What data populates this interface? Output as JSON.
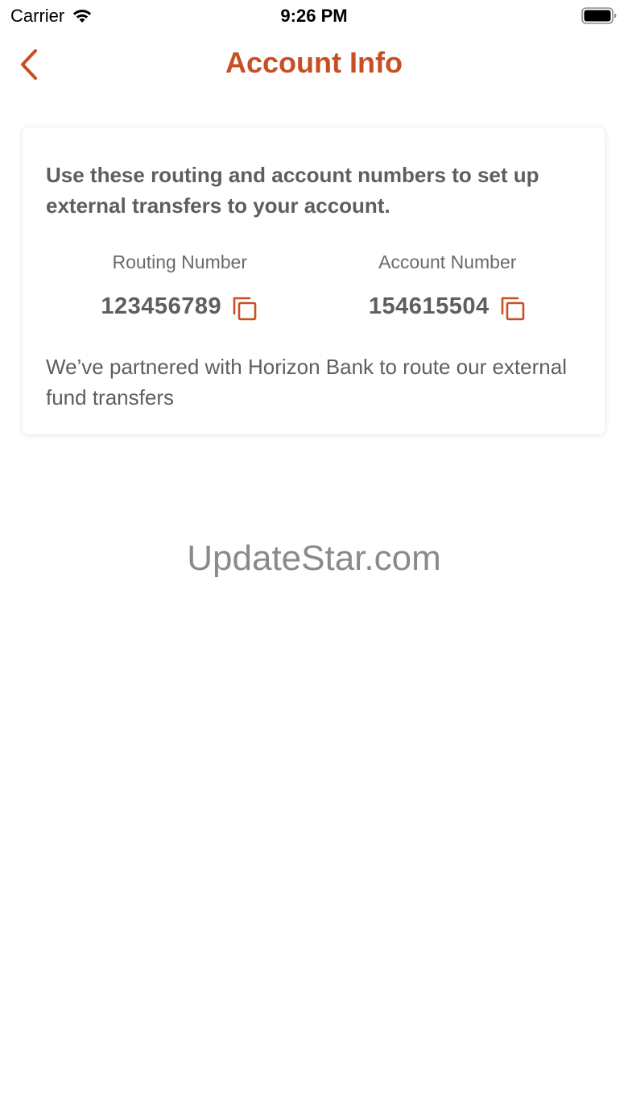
{
  "status_bar": {
    "carrier": "Carrier",
    "time": "9:26 PM"
  },
  "nav": {
    "title": "Account Info",
    "back_icon": "chevron-left-icon"
  },
  "card": {
    "intro": "Use these routing and account numbers to set up external transfers to your account.",
    "routing": {
      "label": "Routing Number",
      "value": "123456789"
    },
    "account": {
      "label": "Account Number",
      "value": "154615504"
    },
    "partner_note": "We’ve partnered with Horizon Bank to route our external fund transfers"
  },
  "watermark": "UpdateStar.com",
  "colors": {
    "accent": "#c64f23",
    "text": "#5e5e5e",
    "watermark": "#8a8a8a"
  }
}
